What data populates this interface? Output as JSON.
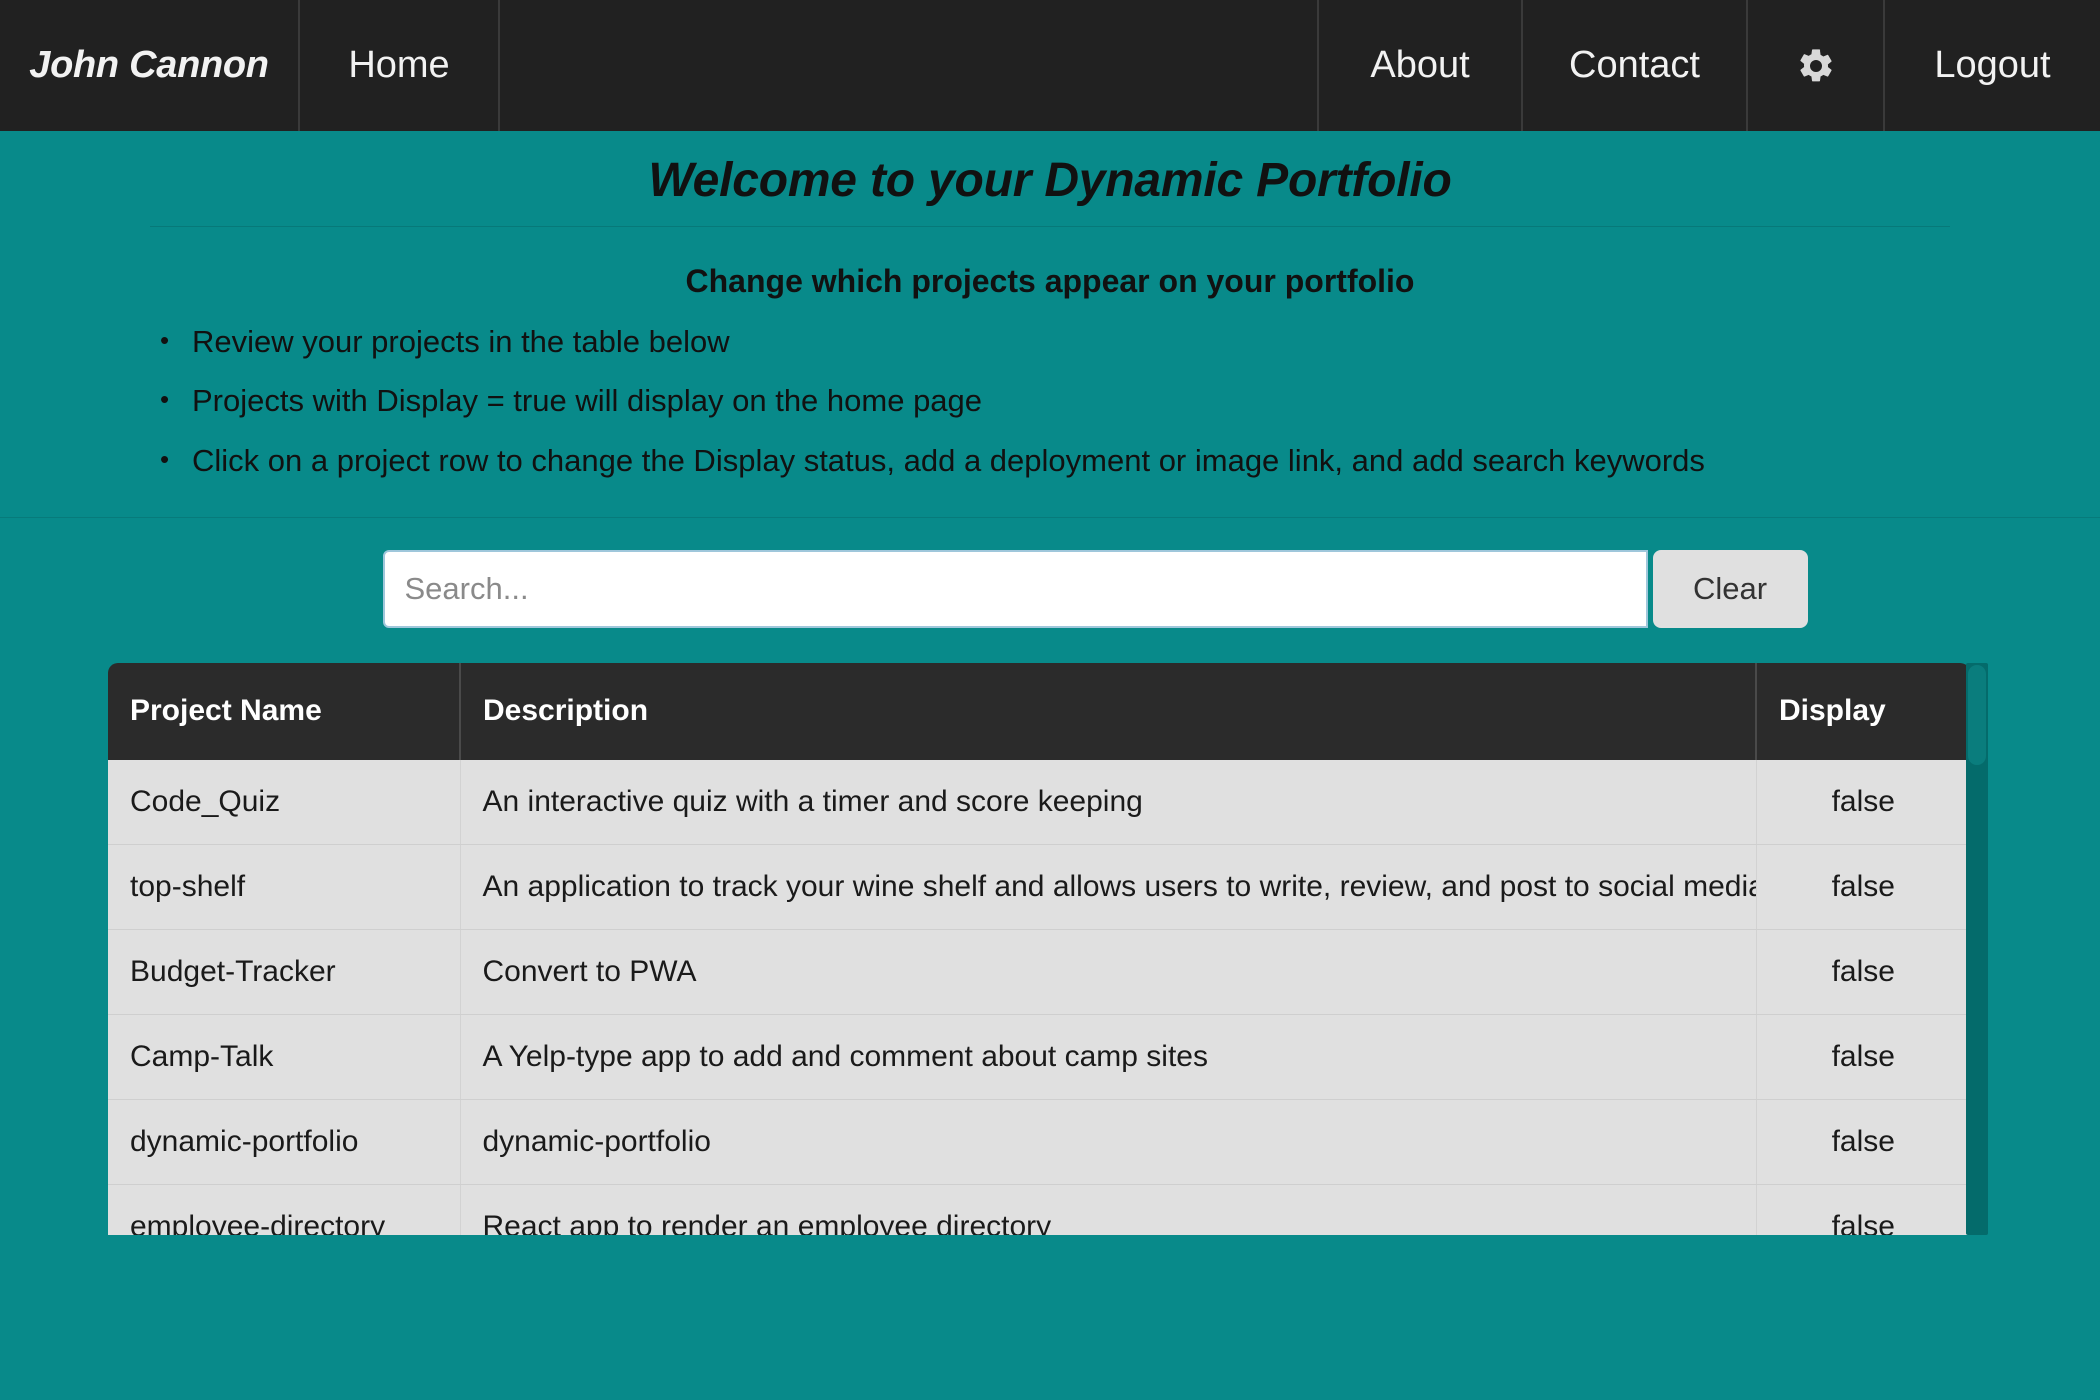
{
  "navbar": {
    "brand": "John Cannon",
    "home": "Home",
    "about": "About",
    "contact": "Contact",
    "gear_icon": "gear-icon",
    "logout": "Logout",
    "background_color": "#212121",
    "text_color": "#f2f2f2"
  },
  "header": {
    "title": "Welcome to your Dynamic Portfolio",
    "subtitle": "Change which projects appear on your portfolio",
    "bullets": [
      "Review your projects in the table below",
      "Projects with Display = true will display on the home page",
      "Click on a project row to change the Display status, add a deployment or image link, and add search keywords"
    ],
    "background_color": "#088a8a"
  },
  "search": {
    "value": "",
    "placeholder": "Search...",
    "clear_label": "Clear"
  },
  "table": {
    "columns": [
      "Project Name",
      "Description",
      "Display"
    ],
    "rows": [
      {
        "name": "Code_Quiz",
        "description": "An interactive quiz with a timer and score keeping",
        "display": "false"
      },
      {
        "name": "top-shelf",
        "description": "An application to track your wine shelf and allows users to write, review, and post to social media.",
        "display": "false"
      },
      {
        "name": "Budget-Tracker",
        "description": "Convert to PWA",
        "display": "false"
      },
      {
        "name": "Camp-Talk",
        "description": "A Yelp-type app to add and comment about camp sites",
        "display": "false"
      },
      {
        "name": "dynamic-portfolio",
        "description": "dynamic-portfolio",
        "display": "false"
      },
      {
        "name": "employee-directory",
        "description": "React app to render an employee directory",
        "display": "false"
      }
    ]
  }
}
